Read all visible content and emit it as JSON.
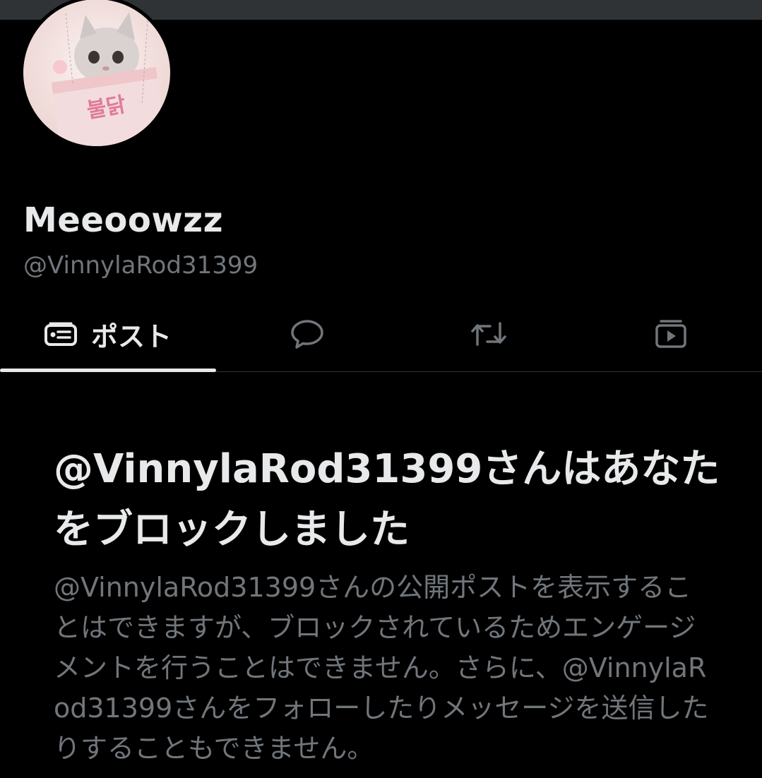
{
  "profile": {
    "display_name": "Meeoowzz",
    "handle": "@VinnylaRod31399",
    "avatar_alt": "cat-in-cup-avatar"
  },
  "tabs": [
    {
      "label": "ポスト",
      "icon": "posts-icon",
      "active": true
    },
    {
      "label": "",
      "icon": "reply-bubble-icon",
      "active": false
    },
    {
      "label": "",
      "icon": "repost-icon",
      "active": false
    },
    {
      "label": "",
      "icon": "media-icon",
      "active": false
    }
  ],
  "blocked_notice": {
    "title": "@VinnylaRod31399さんはあなたをブロックしました",
    "description": "@VinnylaRod31399さんの公開ポストを表示することはできますが、ブロックされているためエンゲージメントを行うことはできません。さらに、@VinnylaRod31399さんをフォローしたりメッセージを送信したりすることもできません。"
  },
  "colors": {
    "background": "#000000",
    "banner": "#2f3336",
    "primary_text": "#e7e9ea",
    "secondary_text": "#71767b",
    "divider": "#2f3336"
  }
}
